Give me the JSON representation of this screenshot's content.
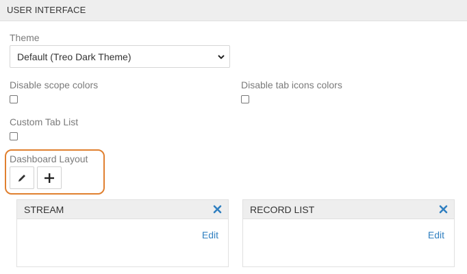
{
  "panel": {
    "title": "USER INTERFACE"
  },
  "theme": {
    "label": "Theme",
    "value": "Default (Treo Dark Theme)"
  },
  "options": {
    "disable_scope_colors": {
      "label": "Disable scope colors",
      "checked": false
    },
    "disable_tab_icons_colors": {
      "label": "Disable tab icons colors",
      "checked": false
    },
    "custom_tab_list": {
      "label": "Custom Tab List",
      "checked": false
    }
  },
  "dashboard": {
    "label": "Dashboard Layout",
    "edit_icon": "pencil-icon",
    "add_icon": "plus-icon",
    "highlight_color": "#e07f2e"
  },
  "dashlets": [
    {
      "title": "STREAM",
      "edit_label": "Edit"
    },
    {
      "title": "RECORD LIST",
      "edit_label": "Edit"
    }
  ],
  "colors": {
    "link": "#2f7fc0",
    "close": "#2f7fc0",
    "header_bg": "#eeeeee"
  }
}
